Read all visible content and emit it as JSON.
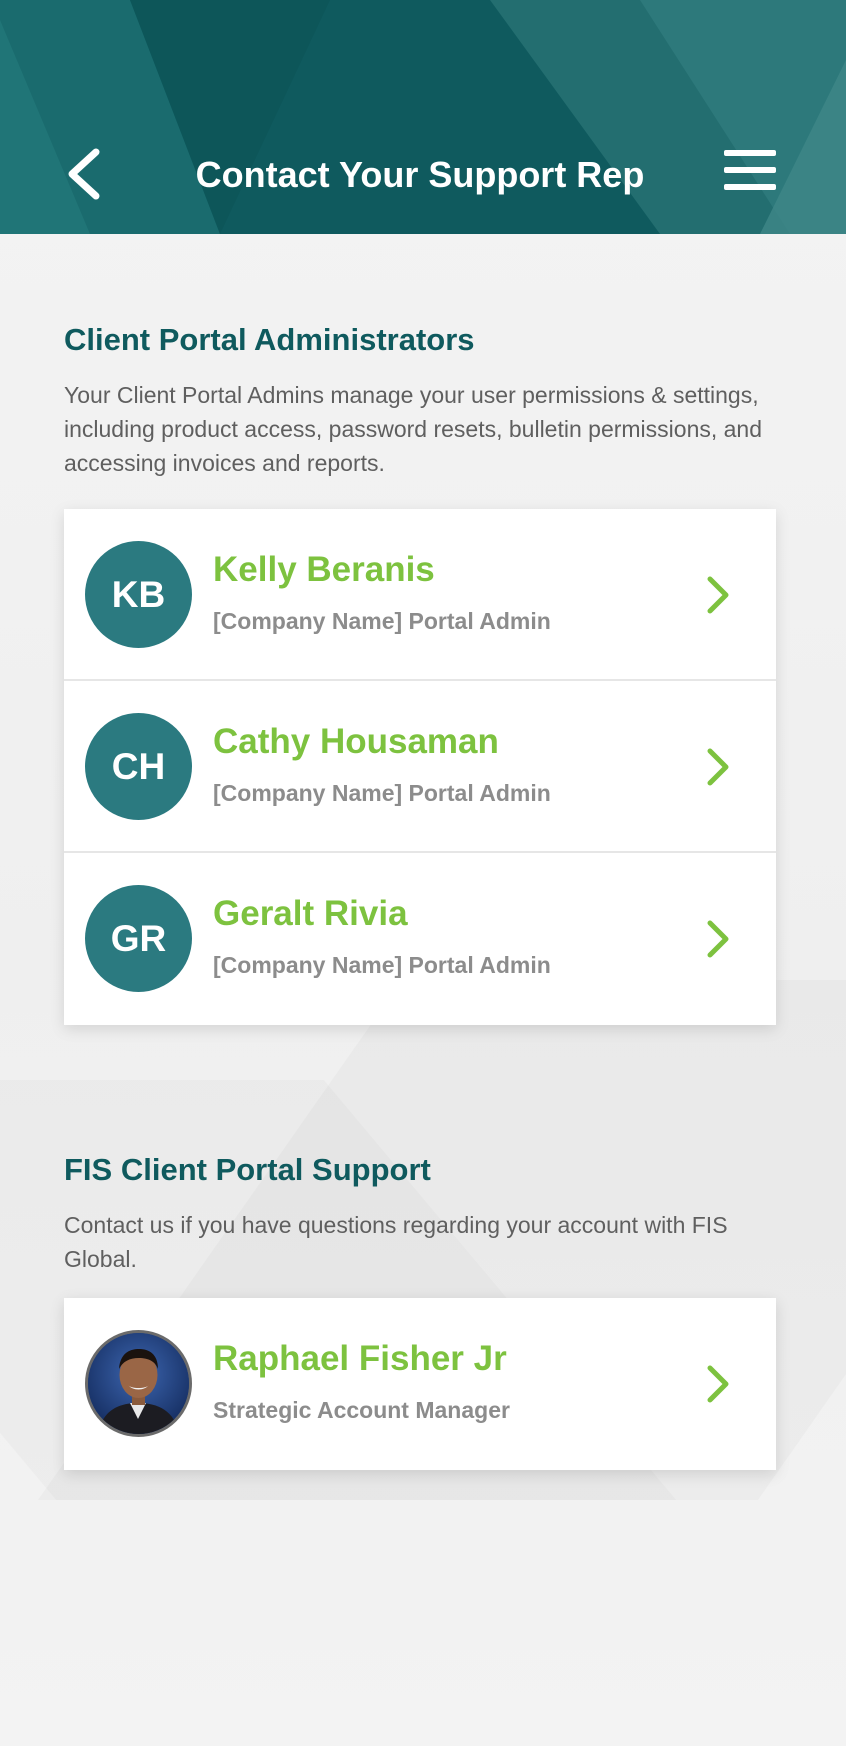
{
  "header": {
    "title": "Contact Your Support Rep",
    "back_icon": "chevron-left-icon",
    "menu_icon": "hamburger-menu-icon",
    "color": "#0f5a5e"
  },
  "admins_section": {
    "title": "Client Portal Administrators",
    "description": "Your Client Portal Admins manage your user permissions & settings, including product access, password resets, bulletin permissions, and accessing invoices and reports.",
    "contacts": [
      {
        "initials": "KB",
        "name": "Kelly Beranis",
        "role": "[Company Name] Portal Admin"
      },
      {
        "initials": "CH",
        "name": "Cathy Housaman",
        "role": "[Company Name] Portal Admin"
      },
      {
        "initials": "GR",
        "name": "Geralt Rivia",
        "role": "[Company Name] Portal Admin"
      }
    ]
  },
  "support_section": {
    "title": "FIS Client Portal Support",
    "description": "Contact us if you have questions regarding your account with FIS Global.",
    "contacts": [
      {
        "name": "Raphael Fisher Jr",
        "role": "Strategic Account Manager",
        "avatar": "photo"
      }
    ]
  },
  "colors": {
    "accent_green": "#7dc23f",
    "avatar_teal": "#2b7a80",
    "title_teal": "#0f5a5e"
  }
}
